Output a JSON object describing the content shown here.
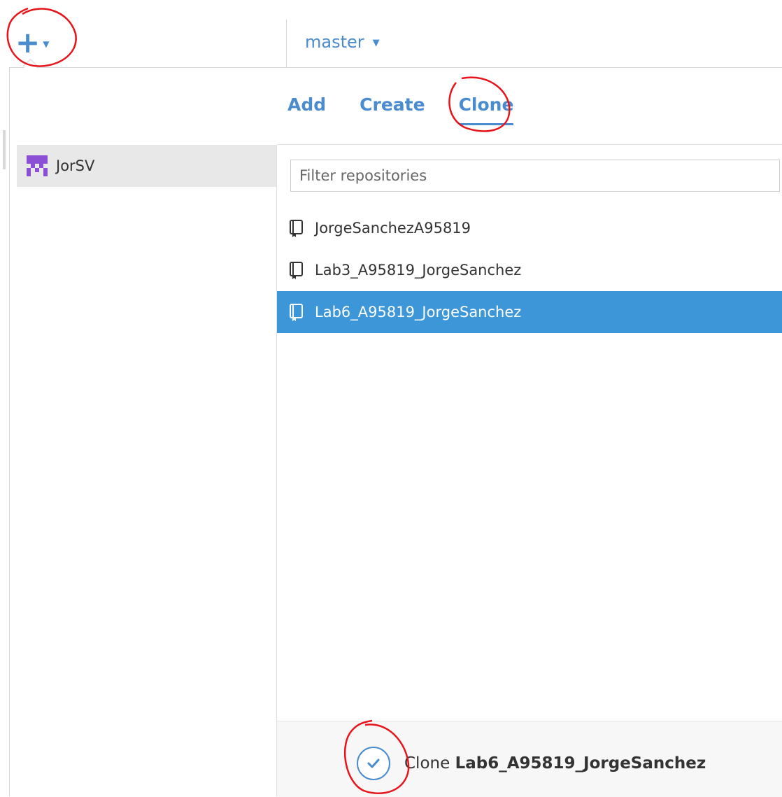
{
  "toolbar": {
    "add_icon": "plus-icon",
    "branch": "master"
  },
  "popover": {
    "tabs": [
      {
        "label": "Add",
        "active": false
      },
      {
        "label": "Create",
        "active": false
      },
      {
        "label": "Clone",
        "active": true
      }
    ],
    "accounts": [
      {
        "name": "JorSV",
        "selected": true
      }
    ],
    "filter": {
      "placeholder": "Filter repositories",
      "value": ""
    },
    "repositories": [
      {
        "name": "JorgeSanchezA95819",
        "selected": false
      },
      {
        "name": "Lab3_A95819_JorgeSanchez",
        "selected": false
      },
      {
        "name": "Lab6_A95819_JorgeSanchez",
        "selected": true
      }
    ],
    "footer": {
      "action_label": "Clone",
      "repo_name": "Lab6_A95819_JorgeSanchez"
    }
  },
  "colors": {
    "accent": "#4a8ccd",
    "selection": "#3c96d8",
    "avatar": "#8b4fd6",
    "annotation": "#e8141b"
  }
}
